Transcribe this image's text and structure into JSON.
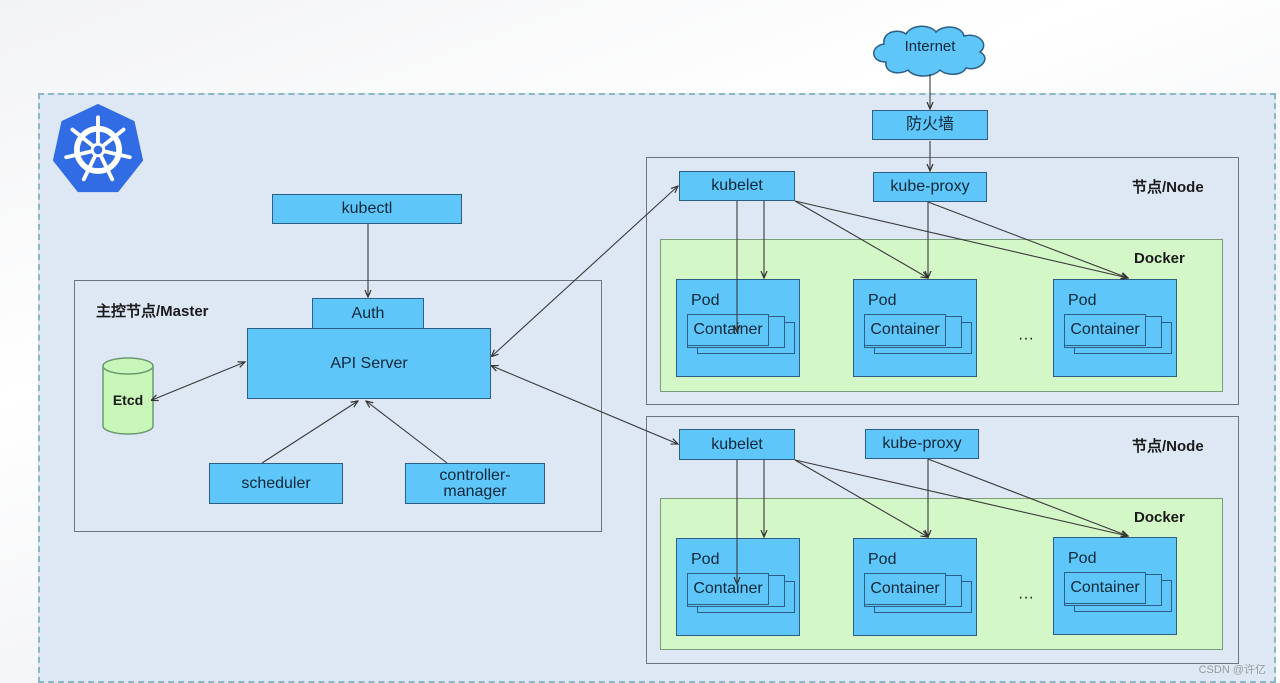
{
  "diagram": {
    "internet_label": "Internet",
    "firewall_label": "防火墙",
    "master": {
      "title": "主控节点/Master",
      "kubectl_label": "kubectl",
      "auth_label": "Auth",
      "api_server_label": "API Server",
      "etcd_label": "Etcd",
      "scheduler_label": "scheduler",
      "controller_manager_label": "controller-\nmanager"
    },
    "nodes": [
      {
        "title": "节点/Node",
        "kubelet_label": "kubelet",
        "kube_proxy_label": "kube-proxy",
        "docker_label": "Docker",
        "pods": [
          {
            "label": "Pod",
            "container_label": "Container"
          },
          {
            "label": "Pod",
            "container_label": "Container"
          },
          {
            "label": "Pod",
            "container_label": "Container"
          }
        ],
        "ellipsis": "···"
      },
      {
        "title": "节点/Node",
        "kubelet_label": "kubelet",
        "kube_proxy_label": "kube-proxy",
        "docker_label": "Docker",
        "pods": [
          {
            "label": "Pod",
            "container_label": "Container"
          },
          {
            "label": "Pod",
            "container_label": "Container"
          },
          {
            "label": "Pod",
            "container_label": "Container"
          }
        ],
        "ellipsis": "···"
      }
    ],
    "logo_icon": "kubernetes-helm-icon",
    "colors": {
      "component_fill": "#5ec6f8",
      "docker_fill": "#d3f7c6",
      "etcd_fill": "#c8f5b8",
      "cluster_bg": "#dde8f4",
      "logo_blue": "#326ce5"
    }
  },
  "watermark": "CSDN @许亿"
}
